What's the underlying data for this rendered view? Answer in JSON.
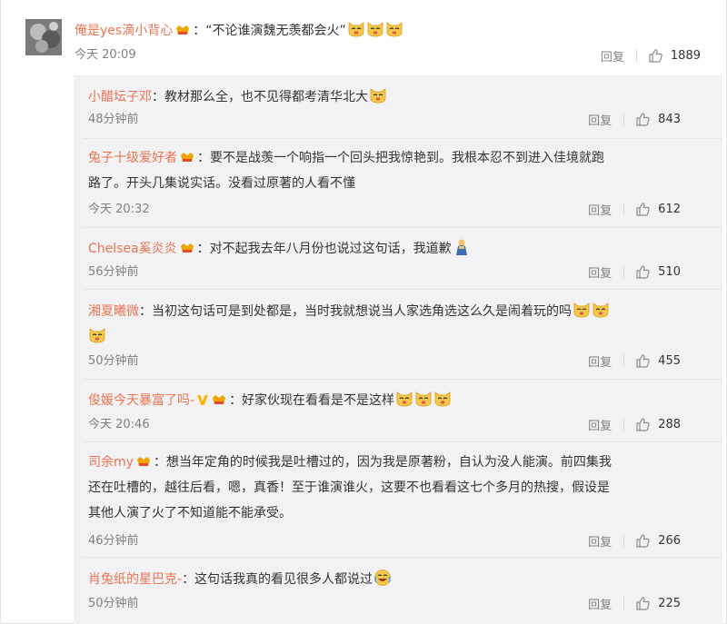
{
  "colors": {
    "username": "#eb7350",
    "text": "#333333",
    "meta": "#808080",
    "reply_bg": "#f2f2f5"
  },
  "main": {
    "username": "俺是yes滴小背心",
    "text": "：“不论谁演魏无羡都会火”",
    "emoji_count": 3,
    "time": "今天 20:09",
    "reply_label": "回复",
    "likes": "1889"
  },
  "replies": [
    {
      "username": "小醋坛子邓",
      "vip": false,
      "text": "：教材那么全，也不见得都考清华北大",
      "emojis": [
        "cat"
      ],
      "time": "48分钟前",
      "reply_label": "回复",
      "likes": "843"
    },
    {
      "username": "兔子十级爱好者",
      "vip": true,
      "text": "：要不是战羡一个响指一个回头把我惊艳到。我根本忍不到进入佳境就跑",
      "text2": "路了。开头几集说实话。没看过原著的人看不懂",
      "emojis": [],
      "time": "今天 20:32",
      "reply_label": "回复",
      "likes": "612"
    },
    {
      "username": "Chelsea奚炎炎",
      "vip": true,
      "text": "：对不起我去年八月份也说过这句话，我道歉",
      "emojis": [
        "bow"
      ],
      "time": "56分钟前",
      "reply_label": "回复",
      "likes": "510"
    },
    {
      "username": "湘夏曦微",
      "vip": false,
      "text": "：当初这句话可是到处都是，当时我就想说当人家选角选这么久是闹着玩的吗",
      "emojis": [
        "cat",
        "cat"
      ],
      "text2_emojis": [
        "cat"
      ],
      "time": "50分钟前",
      "reply_label": "回复",
      "likes": "455"
    },
    {
      "username": "俊媛今天暴富了吗-",
      "vip": true,
      "vbadge": true,
      "text": "：好家伙现在看看是不是这样",
      "emojis": [
        "cat",
        "cat",
        "cat"
      ],
      "time": "今天 20:46",
      "reply_label": "回复",
      "likes": "288"
    },
    {
      "username": "司余my",
      "vip": true,
      "text": "：想当年定角的时候我是吐槽过的，因为我是原著粉，自认为没人能演。前四集我",
      "text2": "还在吐槽的，越往后看，嗯，真香！至于谁演谁火，这要不也看看这七个多月的热搜，假设是",
      "text3": "其他人演了火了不知道能不能承受。",
      "emojis": [],
      "time": "46分钟前",
      "reply_label": "回复",
      "likes": "266"
    },
    {
      "username": "肖兔纸的星巴克-",
      "vip": false,
      "text": "：这句话我真的看见很多人都说过",
      "emojis": [
        "laugh"
      ],
      "time": "50分钟前",
      "reply_label": "回复",
      "likes": "225"
    }
  ]
}
